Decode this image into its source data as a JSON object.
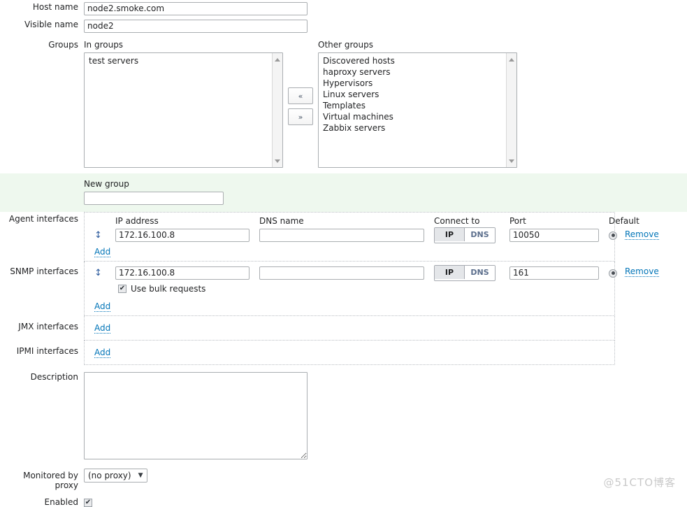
{
  "form": {
    "host_name": {
      "label": "Host name",
      "value": "node2.smoke.com"
    },
    "visible_name": {
      "label": "Visible name",
      "value": "node2"
    },
    "groups": {
      "label": "Groups",
      "in_groups_caption": "In groups",
      "in_groups": [
        "test servers"
      ],
      "other_groups_caption": "Other groups",
      "other_groups": [
        "Discovered hosts",
        "haproxy servers",
        "Hypervisors",
        "Linux servers",
        "Templates",
        "Virtual machines",
        "Zabbix servers"
      ],
      "move_left_label": "«",
      "move_right_label": "»"
    },
    "new_group": {
      "caption": "New group",
      "value": "",
      "placeholder": ""
    },
    "interface_columns": {
      "ip_address": "IP address",
      "dns_name": "DNS name",
      "connect_to": "Connect to",
      "port": "Port",
      "default": "Default"
    },
    "agent_interfaces": {
      "label": "Agent interfaces",
      "handle": "↕",
      "ip": "172.16.100.8",
      "dns": "",
      "connect_ip": "IP",
      "connect_dns": "DNS",
      "port": "10050",
      "add_label": "Add",
      "remove_label": "Remove"
    },
    "snmp_interfaces": {
      "label": "SNMP interfaces",
      "handle": "↕",
      "ip": "172.16.100.8",
      "dns": "",
      "connect_ip": "IP",
      "connect_dns": "DNS",
      "port": "161",
      "bulk_label": "Use bulk requests",
      "bulk_checked_glyph": "✔",
      "add_label": "Add",
      "remove_label": "Remove"
    },
    "jmx_interfaces": {
      "label": "JMX interfaces",
      "add_label": "Add"
    },
    "ipmi_interfaces": {
      "label": "IPMI interfaces",
      "add_label": "Add"
    },
    "description": {
      "label": "Description",
      "value": "",
      "placeholder": ""
    },
    "proxy": {
      "label": "Monitored by proxy",
      "value": "(no proxy)",
      "caret": "▼"
    },
    "enabled": {
      "label": "Enabled",
      "checked_glyph": "✔"
    }
  },
  "watermark": {
    "text": "@51CTO博客"
  },
  "colors": {
    "link": "#0275b8",
    "new_group_band": "#eef8ee",
    "input_border": "#aaaeb1",
    "segment_active_bg": "#e4e6e9",
    "segment_inactive_text": "#5b6e8c",
    "handle_blue": "#2e5c9e"
  }
}
